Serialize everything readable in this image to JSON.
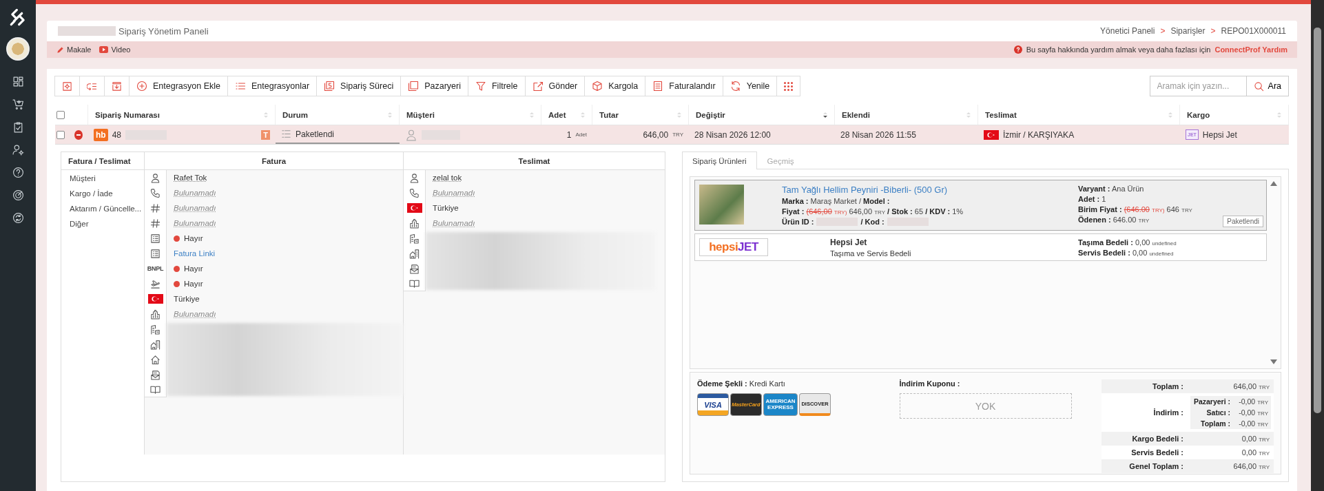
{
  "header": {
    "title": "Sipariş Yönetim Paneli",
    "breadcrumbs": [
      {
        "label": "Yönetici Paneli"
      },
      {
        "separator": ">",
        "label": "Siparişler"
      },
      {
        "separator": ">",
        "label": "REPO01X000011"
      }
    ]
  },
  "help_bar": {
    "links": [
      "Makale",
      "Video"
    ],
    "message": "Bu sayfa hakkında yardım almak veya daha fazlası için",
    "link": "ConnectProf Yardım"
  },
  "toolbar": {
    "buttons": [
      "Entegrasyon Ekle",
      "Entegrasyonlar",
      "Sipariş Süreci",
      "Pazaryeri",
      "Filtrele",
      "Gönder",
      "Kargola",
      "Faturalandır",
      "Yenile"
    ],
    "search": {
      "placeholder": "Aramak için yazın...",
      "button": "Ara"
    }
  },
  "table": {
    "select_all_checked": false,
    "columns": [
      {
        "label": "Sipariş Numarası",
        "sorted": false
      },
      {
        "label": "Durum",
        "sorted": false
      },
      {
        "label": "Müşteri",
        "sorted": false
      },
      {
        "label": "Adet",
        "sorted": false
      },
      {
        "label": "Tutar",
        "sorted": false
      },
      {
        "label": "Değiştir",
        "sorted": true
      },
      {
        "label": "Eklendi",
        "sorted": false
      },
      {
        "label": "Teslimat",
        "sorted": false
      },
      {
        "label": "Kargo",
        "sorted": false
      }
    ],
    "rows": [
      {
        "checked": false,
        "expanded": true,
        "marketplace_badge": "hb",
        "order_no": "48",
        "tag": "T",
        "status": "Paketlendi",
        "quantity": "1",
        "quantity_unit": "Adet",
        "amount": "646,00",
        "currency": "TRY",
        "modified": "28 Nisan 2026 12:00",
        "added": "28 Nisan 2026 11:55",
        "delivery": "İzmir / KARŞIYAKA",
        "cargo_badge": "JET",
        "cargo": "Hepsi Jet"
      }
    ]
  },
  "detail": {
    "menu_title": "Fatura / Teslimat",
    "menu": [
      "Müşteri",
      "Kargo / İade",
      "Aktarım / Güncelle...",
      "Diğer"
    ],
    "invoice": {
      "title": "Fatura",
      "rows": [
        {
          "kind": "text",
          "value": "Rafet Tok"
        },
        {
          "kind": "missing",
          "value": "Bulunamadı"
        },
        {
          "kind": "missing",
          "value": "Bulunamadı"
        },
        {
          "kind": "missing",
          "value": "Bulunamadı"
        },
        {
          "kind": "status",
          "value": "Hayır",
          "on": false
        },
        {
          "kind": "link",
          "value": "Fatura Linki"
        },
        {
          "kind": "status",
          "value": "Hayır",
          "on": false,
          "icon_label": "BNPL"
        },
        {
          "kind": "status",
          "value": "Hayır",
          "on": false
        },
        {
          "kind": "country",
          "value": "Türkiye"
        },
        {
          "kind": "missing",
          "value": "Bulunamadı"
        },
        {
          "kind": "redacted"
        },
        {
          "kind": "redacted"
        },
        {
          "kind": "redacted"
        },
        {
          "kind": "redacted"
        },
        {
          "kind": "redacted"
        }
      ]
    },
    "shipping": {
      "title": "Teslimat",
      "rows": [
        {
          "kind": "text",
          "value": "zelal tok"
        },
        {
          "kind": "missing",
          "value": "Bulunamadı"
        },
        {
          "kind": "country",
          "value": "Türkiye"
        },
        {
          "kind": "missing",
          "value": "Bulunamadı"
        },
        {
          "kind": "redacted"
        },
        {
          "kind": "redacted"
        },
        {
          "kind": "redacted"
        },
        {
          "kind": "redacted"
        }
      ]
    }
  },
  "order_panel": {
    "tabs": [
      {
        "label": "Sipariş Ürünleri",
        "selected": true
      },
      {
        "label": "Geçmiş",
        "selected": false
      }
    ],
    "product": {
      "title": "Tam Yağlı Hellim Peyniri -Biberli- (500 Gr)",
      "left_lines": [
        [
          {
            "kind": "label",
            "v": "Marka :"
          },
          {
            "kind": "text",
            "v": "Maraş Market /"
          },
          {
            "kind": "label",
            "v": "Model :"
          }
        ],
        [
          {
            "kind": "label",
            "v": "Fiyat :"
          },
          {
            "kind": "old",
            "v": "(646,00"
          },
          {
            "kind": "old-small",
            "v": "TRY)"
          },
          {
            "kind": "text",
            "v": "646,00"
          },
          {
            "kind": "small",
            "v": "TRY"
          },
          {
            "kind": "label",
            "v": "/ Stok :"
          },
          {
            "kind": "text",
            "v": "65"
          },
          {
            "kind": "label",
            "v": "/ KDV :"
          },
          {
            "kind": "text",
            "v": "1%"
          }
        ],
        [
          {
            "kind": "label",
            "v": "Ürün ID :"
          },
          {
            "kind": "redacted"
          },
          {
            "kind": "label",
            "v": "/ Kod :"
          },
          {
            "kind": "redacted"
          }
        ]
      ],
      "right_lines": [
        [
          {
            "kind": "label",
            "v": "Varyant :"
          },
          {
            "kind": "text",
            "v": "Ana Ürün"
          }
        ],
        [
          {
            "kind": "label",
            "v": "Adet :"
          },
          {
            "kind": "text",
            "v": "1"
          }
        ],
        [
          {
            "kind": "label",
            "v": "Birim Fiyat :"
          },
          {
            "kind": "old",
            "v": "(646.00"
          },
          {
            "kind": "old-small",
            "v": "TRY)"
          },
          {
            "kind": "text",
            "v": "646"
          },
          {
            "kind": "small",
            "v": "TRY"
          }
        ],
        [
          {
            "kind": "label",
            "v": "Ödenen :"
          },
          {
            "kind": "text",
            "v": "646.00"
          },
          {
            "kind": "small",
            "v": "TRY"
          }
        ]
      ],
      "status": "Paketlendi"
    },
    "shipment": {
      "logo": {
        "first": "hepsi",
        "second": "JET"
      },
      "name": "Hepsi Jet",
      "description": "Taşıma ve Servis Bedeli",
      "lines": [
        [
          {
            "kind": "label",
            "v": "Taşıma Bedeli :"
          },
          {
            "kind": "text",
            "v": "0,00"
          },
          {
            "kind": "small",
            "v": "undefined"
          }
        ],
        [
          {
            "kind": "label",
            "v": "Servis Bedeli :"
          },
          {
            "kind": "text",
            "v": "0,00"
          },
          {
            "kind": "small",
            "v": "undefined"
          }
        ]
      ]
    },
    "payment": {
      "label": "Ödeme Şekli :",
      "value": "Kredi Kartı",
      "cards": [
        {
          "kind": "visa",
          "label": "VISA"
        },
        {
          "kind": "mastercard",
          "label": "MasterCard"
        },
        {
          "kind": "amex",
          "label": "AMERICAN EXPRESS"
        },
        {
          "kind": "discover",
          "label": "DISCOVER"
        }
      ]
    },
    "coupon": {
      "label": "İndirim Kuponu :",
      "value": "YOK"
    },
    "totals": [
      {
        "label": "Toplam :",
        "value": "646,00",
        "currency": "TRY"
      },
      {
        "label": "İndirim :",
        "sub": [
          {
            "label": "Pazaryeri :",
            "value": "-0,00",
            "currency": "TRY"
          },
          {
            "label": "Satıcı :",
            "value": "-0,00",
            "currency": "TRY"
          },
          {
            "label": "Toplam :",
            "value": "-0,00",
            "currency": "TRY"
          }
        ]
      },
      {
        "label": "Kargo Bedeli :",
        "value": "0,00",
        "currency": "TRY"
      },
      {
        "label": "Servis Bedeli :",
        "value": "0,00",
        "currency": "TRY"
      },
      {
        "label": "Genel Toplam :",
        "value": "646,00",
        "currency": "TRY"
      }
    ]
  }
}
